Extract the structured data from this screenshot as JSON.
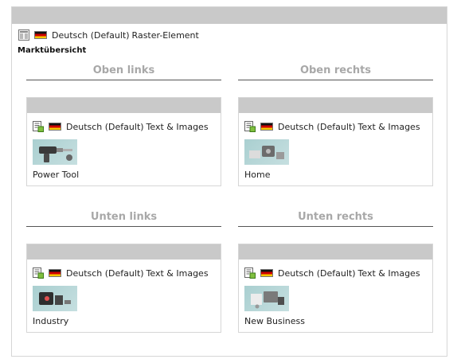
{
  "element": {
    "language": "Deutsch (Default)",
    "type": "Raster-Element",
    "header": "Marktübersicht"
  },
  "columns": [
    {
      "title": "Oben links",
      "content": {
        "language": "Deutsch (Default)",
        "type": "Text & Images",
        "caption": "Power Tool",
        "image_icon": "power-tool-image"
      }
    },
    {
      "title": "Oben rechts",
      "content": {
        "language": "Deutsch (Default)",
        "type": "Text & Images",
        "caption": "Home",
        "image_icon": "home-image"
      }
    },
    {
      "title": "Unten links",
      "content": {
        "language": "Deutsch (Default)",
        "type": "Text & Images",
        "caption": "Industry",
        "image_icon": "industry-image"
      }
    },
    {
      "title": "Unten rechts",
      "content": {
        "language": "Deutsch (Default)",
        "type": "Text & Images",
        "caption": "New Business",
        "image_icon": "new-business-image"
      }
    }
  ],
  "colors": {
    "header_bar": "#c9c9c9",
    "column_title": "#a8a8a8",
    "border": "#d6d6d6",
    "thumbnail_bg": "#a9cfd0"
  }
}
